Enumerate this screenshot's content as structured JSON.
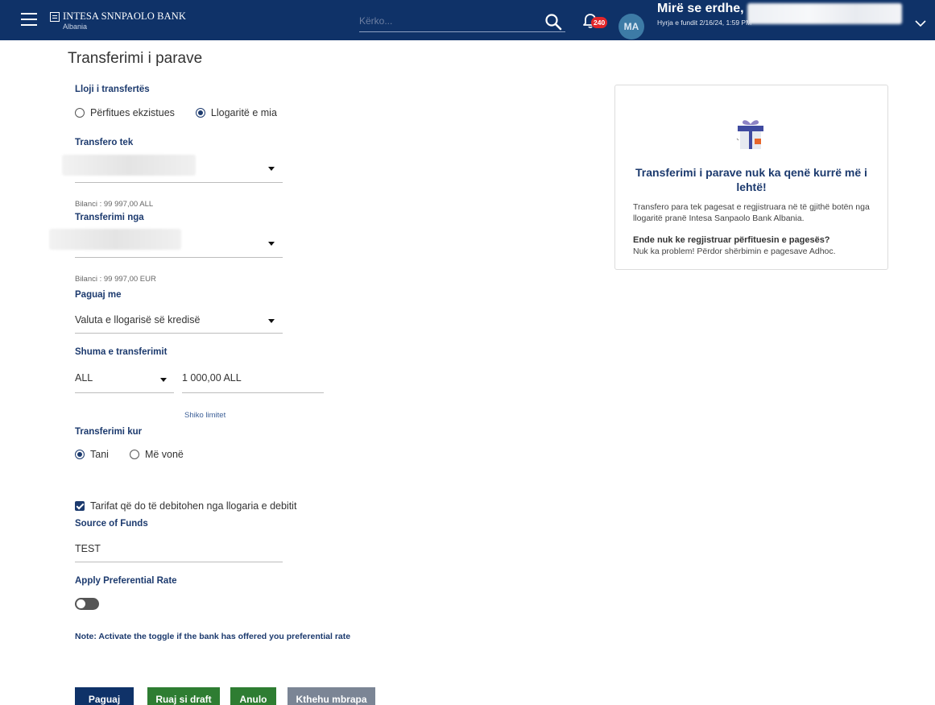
{
  "header": {
    "brand_name": "INTESA SNNPAOLO BANK",
    "brand_sub": "Albania",
    "search_placeholder": "Kërko...",
    "notification_count": "240",
    "avatar_initials": "MA",
    "greeting": "Mirë se erdhe,",
    "last_login": "Hyrja e fundit 2/16/24, 1:59 PM"
  },
  "page": {
    "title": "Transferimi i parave"
  },
  "form": {
    "transfer_type": {
      "label": "Lloji i transfertës",
      "options": [
        "Përfitues ekzistues",
        "Llogaritë e mia"
      ],
      "selected_index": 1
    },
    "transfer_to": {
      "label": "Transfero tek",
      "balance": "Bilanci : 99 997,00 ALL"
    },
    "transfer_from": {
      "label": "Transferimi nga",
      "balance": "Bilanci : 99 997,00 EUR"
    },
    "pay_with": {
      "label": "Paguaj me",
      "value": "Valuta e llogarisë së kredisë"
    },
    "amount": {
      "label": "Shuma e transferimit",
      "currency": "ALL",
      "value": "1 000,00 ALL",
      "limits_link": "Shiko limitet"
    },
    "transfer_when": {
      "label": "Transferimi kur",
      "options": [
        "Tani",
        "Më vonë"
      ],
      "selected_index": 0
    },
    "fees_checkbox": {
      "label": "Tarifat që do të debitohen nga llogaria e debitit",
      "checked": true
    },
    "source_of_funds": {
      "label": "Source of Funds",
      "value": "TEST"
    },
    "preferential_rate": {
      "label": "Apply Preferential Rate",
      "enabled": false,
      "note": "Note: Activate the toggle if the bank has offered you preferential rate"
    }
  },
  "buttons": {
    "pay": "Paguaj",
    "save_draft": "Ruaj si draft",
    "cancel": "Anulo",
    "back": "Kthehu mbrapa"
  },
  "promo": {
    "title": "Transferimi i parave nuk ka qenë kurrë më i lehtë!",
    "text": "Transfero para tek pagesat e regjistruara në të gjithë botën nga llogaritë pranë Intesa Sanpaolo Bank Albania.",
    "question": "Ende nuk ke regjistruar përfituesin e pagesës?",
    "answer": "Nuk ka problem! Përdor shërbimin e pagesave Adhoc."
  },
  "colors": {
    "brand_navy": "#0f3268",
    "label_blue": "#1c3a6e",
    "button_green": "#2e7d32",
    "button_gray": "#7b8595",
    "badge_red": "#e2262a"
  },
  "icons": [
    "menu-icon",
    "search-icon",
    "bell-icon",
    "chevron-down-icon",
    "gift-icon"
  ]
}
